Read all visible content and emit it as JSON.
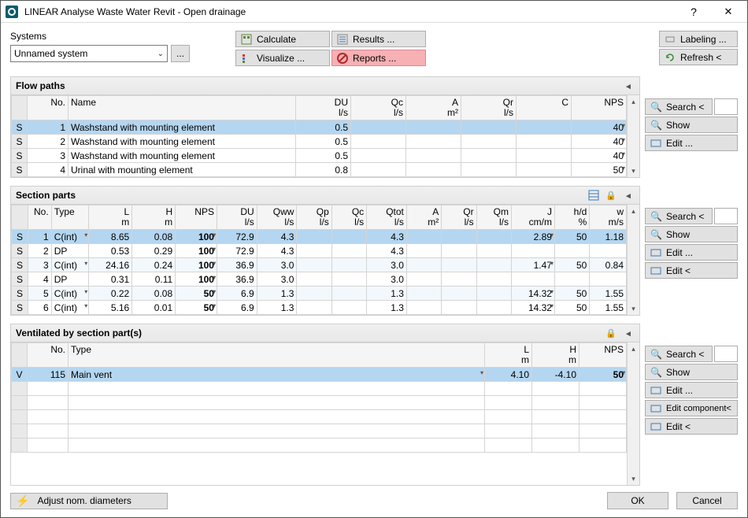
{
  "window": {
    "title": "LINEAR Analyse Waste Water Revit - Open drainage"
  },
  "systems": {
    "label": "Systems",
    "selected": "Unnamed system"
  },
  "toolbar": {
    "calculate": "Calculate",
    "visualize": "Visualize ...",
    "results": "Results ...",
    "reports": "Reports ...",
    "labeling": "Labeling ...",
    "refresh": "Refresh <"
  },
  "flowpaths": {
    "title": "Flow paths",
    "headers": {
      "no": "No.",
      "name": "Name",
      "du": "DU",
      "du_u": "l/s",
      "qc": "Qc",
      "qc_u": "l/s",
      "a": "A",
      "a_u": "m²",
      "qr": "Qr",
      "qr_u": "l/s",
      "c": "C",
      "nps": "NPS"
    },
    "rows": [
      {
        "mk": "S",
        "no": "1",
        "name": "Washstand with mounting element",
        "du": "0.5",
        "qc": "",
        "a": "",
        "qr": "",
        "c": "",
        "nps": "40"
      },
      {
        "mk": "S",
        "no": "2",
        "name": "Washstand with mounting element",
        "du": "0.5",
        "qc": "",
        "a": "",
        "qr": "",
        "c": "",
        "nps": "40"
      },
      {
        "mk": "S",
        "no": "3",
        "name": "Washstand with mounting element",
        "du": "0.5",
        "qc": "",
        "a": "",
        "qr": "",
        "c": "",
        "nps": "40"
      },
      {
        "mk": "S",
        "no": "4",
        "name": "Urinal with mounting element",
        "du": "0.8",
        "qc": "",
        "a": "",
        "qr": "",
        "c": "",
        "nps": "50"
      }
    ],
    "buttons": {
      "search": "Search <",
      "show": "Show",
      "edit": "Edit ..."
    }
  },
  "sectionparts": {
    "title": "Section parts",
    "headers": {
      "no": "No.",
      "type": "Type",
      "l": "L",
      "l_u": "m",
      "h": "H",
      "h_u": "m",
      "nps": "NPS",
      "du": "DU",
      "du_u": "l/s",
      "qww": "Qww",
      "qww_u": "l/s",
      "qp": "Qp",
      "qp_u": "l/s",
      "qc": "Qc",
      "qc_u": "l/s",
      "qtot": "Qtot",
      "qtot_u": "l/s",
      "a": "A",
      "a_u": "m²",
      "qr": "Qr",
      "qr_u": "l/s",
      "qm": "Qm",
      "qm_u": "l/s",
      "j": "J",
      "j_u": "cm/m",
      "hd": "h/d",
      "hd_u": "%",
      "w": "w",
      "w_u": "m/s"
    },
    "rows": [
      {
        "mk": "S",
        "no": "1",
        "type": "C(int)",
        "l": "8.65",
        "h": "0.08",
        "nps": "100",
        "du": "72.9",
        "qww": "4.3",
        "qp": "",
        "qc": "",
        "qtot": "4.3",
        "a": "",
        "qr": "",
        "qm": "",
        "j": "2.89",
        "hd": "50",
        "w": "1.18"
      },
      {
        "mk": "S",
        "no": "2",
        "type": "DP",
        "l": "0.53",
        "h": "0.29",
        "nps": "100",
        "du": "72.9",
        "qww": "4.3",
        "qp": "",
        "qc": "",
        "qtot": "4.3",
        "a": "",
        "qr": "",
        "qm": "",
        "j": "",
        "hd": "",
        "w": ""
      },
      {
        "mk": "S",
        "no": "3",
        "type": "C(int)",
        "l": "24.16",
        "h": "0.24",
        "nps": "100",
        "du": "36.9",
        "qww": "3.0",
        "qp": "",
        "qc": "",
        "qtot": "3.0",
        "a": "",
        "qr": "",
        "qm": "",
        "j": "1.47",
        "hd": "50",
        "w": "0.84"
      },
      {
        "mk": "S",
        "no": "4",
        "type": "DP",
        "l": "0.31",
        "h": "0.11",
        "nps": "100",
        "du": "36.9",
        "qww": "3.0",
        "qp": "",
        "qc": "",
        "qtot": "3.0",
        "a": "",
        "qr": "",
        "qm": "",
        "j": "",
        "hd": "",
        "w": ""
      },
      {
        "mk": "S",
        "no": "5",
        "type": "C(int)",
        "l": "0.22",
        "h": "0.08",
        "nps": "50",
        "du": "6.9",
        "qww": "1.3",
        "qp": "",
        "qc": "",
        "qtot": "1.3",
        "a": "",
        "qr": "",
        "qm": "",
        "j": "14.32",
        "hd": "50",
        "w": "1.55"
      },
      {
        "mk": "S",
        "no": "6",
        "type": "C(int)",
        "l": "5.16",
        "h": "0.01",
        "nps": "50",
        "du": "6.9",
        "qww": "1.3",
        "qp": "",
        "qc": "",
        "qtot": "1.3",
        "a": "",
        "qr": "",
        "qm": "",
        "j": "14.32",
        "hd": "50",
        "w": "1.55"
      }
    ],
    "buttons": {
      "search": "Search <",
      "show": "Show",
      "edit": "Edit ...",
      "edit2": "Edit <"
    }
  },
  "ventilated": {
    "title": "Ventilated by section part(s)",
    "headers": {
      "no": "No.",
      "type": "Type",
      "l": "L",
      "l_u": "m",
      "h": "H",
      "h_u": "m",
      "nps": "NPS"
    },
    "rows": [
      {
        "mk": "V",
        "no": "115",
        "type": "Main vent",
        "l": "4.10",
        "h": "-4.10",
        "nps": "50"
      }
    ],
    "buttons": {
      "search": "Search <",
      "show": "Show",
      "edit": "Edit ...",
      "editc": "Edit component<",
      "edit2": "Edit <"
    }
  },
  "footer": {
    "adjust": "Adjust nom. diameters",
    "ok": "OK",
    "cancel": "Cancel"
  }
}
